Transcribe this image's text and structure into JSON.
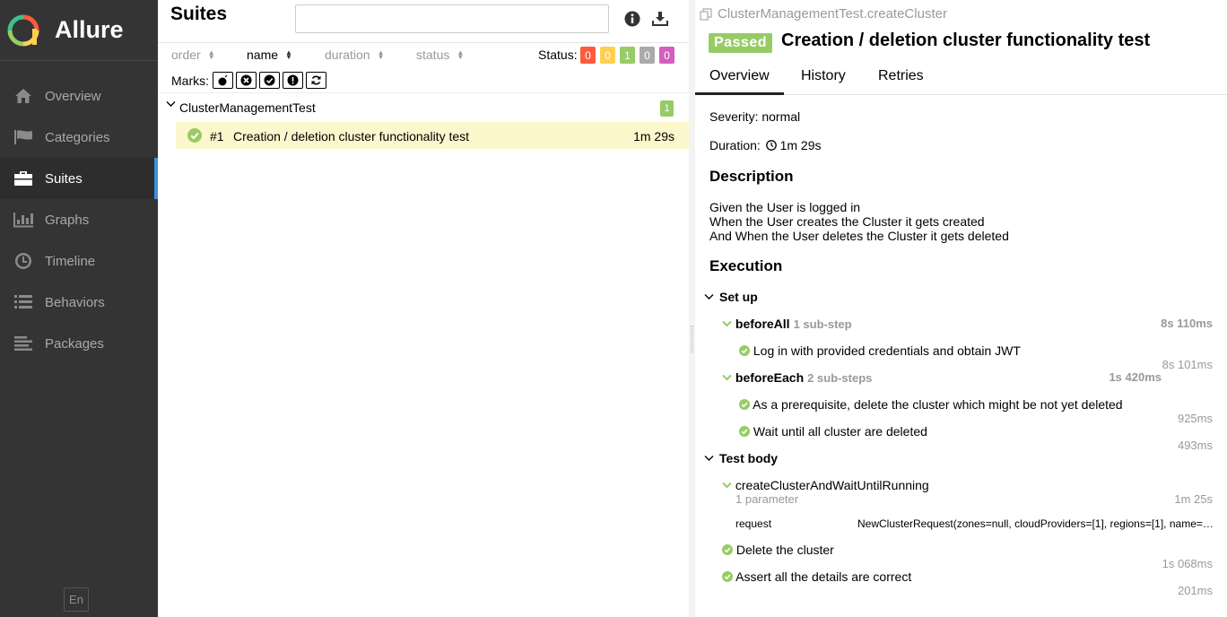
{
  "app": {
    "name": "Allure",
    "language": "En"
  },
  "sidebar": {
    "items": [
      {
        "label": "Overview",
        "icon": "home-icon"
      },
      {
        "label": "Categories",
        "icon": "flag-icon"
      },
      {
        "label": "Suites",
        "icon": "briefcase-icon",
        "active": true
      },
      {
        "label": "Graphs",
        "icon": "bar-chart-icon"
      },
      {
        "label": "Timeline",
        "icon": "clock-icon"
      },
      {
        "label": "Behaviors",
        "icon": "list-icon"
      },
      {
        "label": "Packages",
        "icon": "align-left-icon"
      }
    ]
  },
  "suites": {
    "title": "Suites",
    "search": {
      "value": "",
      "placeholder": ""
    },
    "sort": {
      "order": "order",
      "name": "name",
      "duration": "duration",
      "status": "status"
    },
    "status_label": "Status:",
    "status_counts": [
      {
        "value": "0",
        "color": "#fd5a3e"
      },
      {
        "value": "0",
        "color": "#ffd050"
      },
      {
        "value": "1",
        "color": "#97cc64"
      },
      {
        "value": "0",
        "color": "#aaaaaa"
      },
      {
        "value": "0",
        "color": "#d35ebe"
      }
    ],
    "marks_label": "Marks:",
    "marks": [
      "bomb-icon",
      "close-circle-icon",
      "check-circle-icon",
      "info-icon",
      "refresh-icon"
    ],
    "group": {
      "name": "ClusterManagementTest",
      "count": "1"
    },
    "test": {
      "number": "#1",
      "name": "Creation / deletion cluster functionality test",
      "duration": "1m 29s"
    }
  },
  "detail": {
    "fullname": "ClusterManagementTest.createCluster",
    "status": "Passed",
    "title": "Creation / deletion cluster functionality test",
    "tabs": [
      "Overview",
      "History",
      "Retries"
    ],
    "severity": "Severity: normal",
    "duration_label": "Duration:",
    "duration_value": "1m 29s",
    "description_heading": "Description",
    "description_lines": [
      "Given the User is logged in",
      "When the User creates the Cluster it gets created",
      "And When the User deletes the Cluster it gets deleted"
    ],
    "execution_heading": "Execution",
    "setup_label": "Set up",
    "before_all": {
      "name": "beforeAll",
      "sub": "1 sub-step",
      "duration": "8s 110ms"
    },
    "before_all_step": {
      "name": "Log in with provided credentials and obtain JWT",
      "duration": "8s 101ms"
    },
    "before_each": {
      "name": "beforeEach",
      "sub": "2 sub-steps",
      "duration": "1s 420ms"
    },
    "before_each_steps": [
      {
        "name": "As a prerequisite, delete the cluster which might be not yet deleted",
        "duration": "925ms"
      },
      {
        "name": "Wait until all cluster are deleted",
        "duration": "493ms"
      }
    ],
    "test_body_label": "Test body",
    "create_step": {
      "name": "createClusterAndWaitUntilRunning",
      "params": "1 parameter",
      "duration": "1m 25s"
    },
    "param": {
      "name": "request",
      "value": "NewClusterRequest(zones=null, cloudProviders=[1], regions=[1], name=…"
    },
    "body_steps": [
      {
        "name": "Delete the cluster",
        "duration": "1s 068ms"
      },
      {
        "name": "Assert all the details are correct",
        "duration": "201ms"
      }
    ]
  }
}
